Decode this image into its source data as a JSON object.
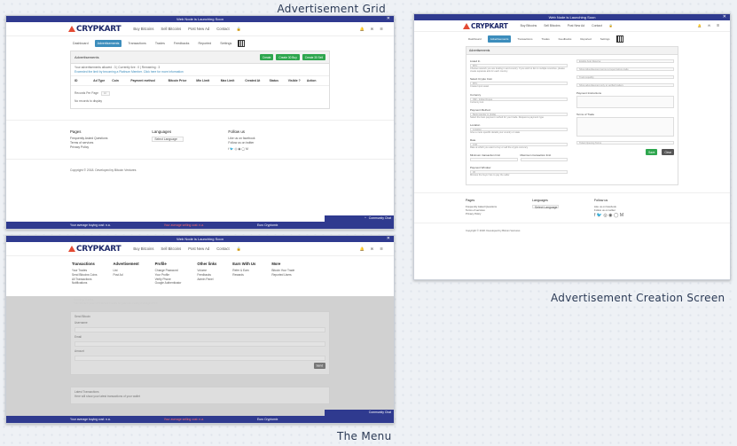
{
  "captions": {
    "grid": "Advertisement Grid",
    "creation": "Advertisement Creation Screen",
    "menu": "The Menu"
  },
  "app": {
    "notice": "Web Node is Launching Soon",
    "logo": "CRYPKART",
    "nav": [
      "Buy Bitcoins",
      "Sell Bitcoins",
      "Post New Ad",
      "Contact",
      "🔒"
    ],
    "nav_right": [
      "🔔",
      "✉",
      "☰"
    ],
    "tabs": [
      "Dashboard",
      "Advertisements",
      "Transactions",
      "Trades",
      "Feedbacks",
      "Reported",
      "Settings"
    ],
    "footer": {
      "pages_title": "Pages",
      "pages": [
        "Frequently Asked Questions",
        "Terms of services",
        "Privacy Policy"
      ],
      "lang_title": "Languages",
      "lang_value": "Select Language",
      "follow_title": "Follow us",
      "follow": [
        "Like us on facebook",
        "Follow us on twitter"
      ],
      "social": "f 🐦 ◎ ◉ ◯ M",
      "copyright": "Copyright © 2018. Developed by Bitcoin Ventures"
    },
    "bottom": {
      "buying": "Your average buying cost: n.a.",
      "selling": "Your average selling cost: n.a.",
      "exchange": "Euro Cryptomix"
    },
    "chat": "Community Chat"
  },
  "grid": {
    "panel_title": "Advertisements",
    "buttons": [
      "Create",
      "Create 30 Buy",
      "Create 30 Sell"
    ],
    "info": [
      "Your advertisements allowed : 3 | Currently live : 0 | Remaining : 3",
      "Exceeded the limit by becoming a Platinum Member. Click here for more information"
    ],
    "columns": [
      "ID",
      "Ad Type",
      "Coin",
      "Payment method",
      "Bitcoin Price",
      "Min Limit",
      "Max Limit",
      "Created At",
      "Status",
      "Visible ?",
      "Action"
    ],
    "records_label": "Records Per Page",
    "records_value": "10",
    "empty": "No records to display"
  },
  "creation": {
    "panel_title": "Advertisements",
    "left": [
      {
        "label": "Listed In",
        "value": "BTC",
        "hint": "Choose network you are trading in and country. If you wish to list in multiple countries, please create separate ads for each country."
      },
      {
        "label": "Select Crypto Coin",
        "value": "BTC",
        "hint": "Create Input asset"
      },
      {
        "label": "Currency",
        "value": "INR - Indian Rupee",
        "hint": "Currency List"
      },
      {
        "label": "Payment Method",
        "value": "Bank transfer in (India)",
        "hint": "Select the best payment method for your trade. Request a payment type"
      },
      {
        "label": "Location",
        "value": "Location",
        "hint": "Give a more specific details your country or state"
      },
      {
        "label": "Rate",
        "value": "0.00",
        "hint": "Rate at which you want to buy or sell the crypto currency"
      },
      {
        "label": "Payment Window",
        "value": "30",
        "hint": "Minutes the buyer has to pay the seller"
      }
    ],
    "min_label": "Minimum transaction limit",
    "max_label": "Maximum transaction limit",
    "right": [
      "Enable Auto Reserve",
      "Show Advertisement terms to buyer before trade",
      "Track Liquidity",
      "Show advertisement only to verified traders"
    ],
    "pay_details": "Payment Instructions",
    "terms": "Terms of Trade",
    "terms_select": "Ticket Opening Terms",
    "save": "Save",
    "cancel": "Clear"
  },
  "menu": {
    "columns": [
      {
        "title": "Transactions",
        "items": [
          "Your Trades",
          "Send Bitcoins Coins",
          "All Transactions",
          "Notifications"
        ]
      },
      {
        "title": "Advertisement",
        "items": [
          "List",
          "Post Ad"
        ]
      },
      {
        "title": "Profile",
        "items": [
          "Change Password",
          "Your Profile",
          "Verify Phone",
          "Google Authenticator"
        ]
      },
      {
        "title": "Other links",
        "items": [
          "Volume",
          "Feedbacks",
          "Admin Panel"
        ]
      },
      {
        "title": "Earn With Us",
        "items": [
          "Refer & Earn",
          "Rewards"
        ]
      },
      {
        "title": "More",
        "items": [
          "Bitcoin Your Trade",
          "Reported Users"
        ]
      }
    ],
    "trading_title": "Sending Trades",
    "trading_text": "You will see your unfinished trades so you can easily manage them",
    "send_title": "Send Bitcoin",
    "send_fields": [
      "Username",
      "Email",
      "Amount"
    ],
    "send_btn": "Send",
    "latest_title": "Latest Transactions",
    "latest_text": "Here will show your latest transactions of your wallet"
  }
}
